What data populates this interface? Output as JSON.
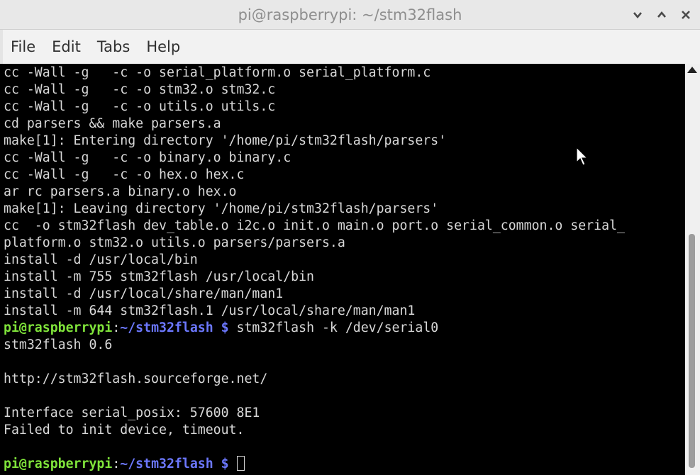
{
  "window": {
    "title": "pi@raspberrypi: ~/stm32flash",
    "controls": [
      "minimize",
      "maximize",
      "close"
    ]
  },
  "menu": {
    "items": [
      "File",
      "Edit",
      "Tabs",
      "Help"
    ]
  },
  "terminal": {
    "lines": [
      "cc -Wall -g   -c -o serial_platform.o serial_platform.c",
      "cc -Wall -g   -c -o stm32.o stm32.c",
      "cc -Wall -g   -c -o utils.o utils.c",
      "cd parsers && make parsers.a",
      "make[1]: Entering directory '/home/pi/stm32flash/parsers'",
      "cc -Wall -g   -c -o binary.o binary.c",
      "cc -Wall -g   -c -o hex.o hex.c",
      "ar rc parsers.a binary.o hex.o",
      "make[1]: Leaving directory '/home/pi/stm32flash/parsers'",
      "cc  -o stm32flash dev_table.o i2c.o init.o main.o port.o serial_common.o serial_",
      "platform.o stm32.o utils.o parsers/parsers.a",
      "install -d /usr/local/bin",
      "install -m 755 stm32flash /usr/local/bin",
      "install -d /usr/local/share/man/man1",
      "install -m 644 stm32flash.1 /usr/local/share/man/man1"
    ],
    "prompt_user": "pi@raspberrypi",
    "prompt_colon": ":",
    "prompt_path": "~/stm32flash $",
    "command": " stm32flash -k /dev/serial0",
    "output": [
      "stm32flash 0.6",
      "",
      "http://stm32flash.sourceforge.net/",
      "",
      "Interface serial_posix: 57600 8E1",
      "Failed to init device, timeout.",
      ""
    ],
    "colors": {
      "background": "#000000",
      "text": "#d8d8d8",
      "prompt_user": "#7fe33a",
      "prompt_path": "#6c78ff"
    }
  }
}
